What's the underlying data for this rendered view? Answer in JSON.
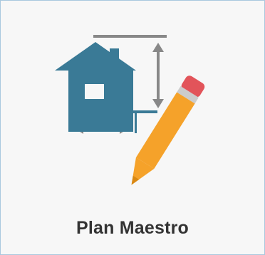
{
  "tile": {
    "label": "Plan Maestro",
    "icon": "house-plan-with-pencil-icon",
    "colors": {
      "background": "#f7f7f7",
      "border": "#a9c8de",
      "house": "#3a7a96",
      "dimension_lines": "#888888",
      "pencil_body": "#f5a22a",
      "pencil_eraser": "#e2545a",
      "pencil_ferrule": "#cccccc",
      "label_text": "#333333"
    }
  }
}
